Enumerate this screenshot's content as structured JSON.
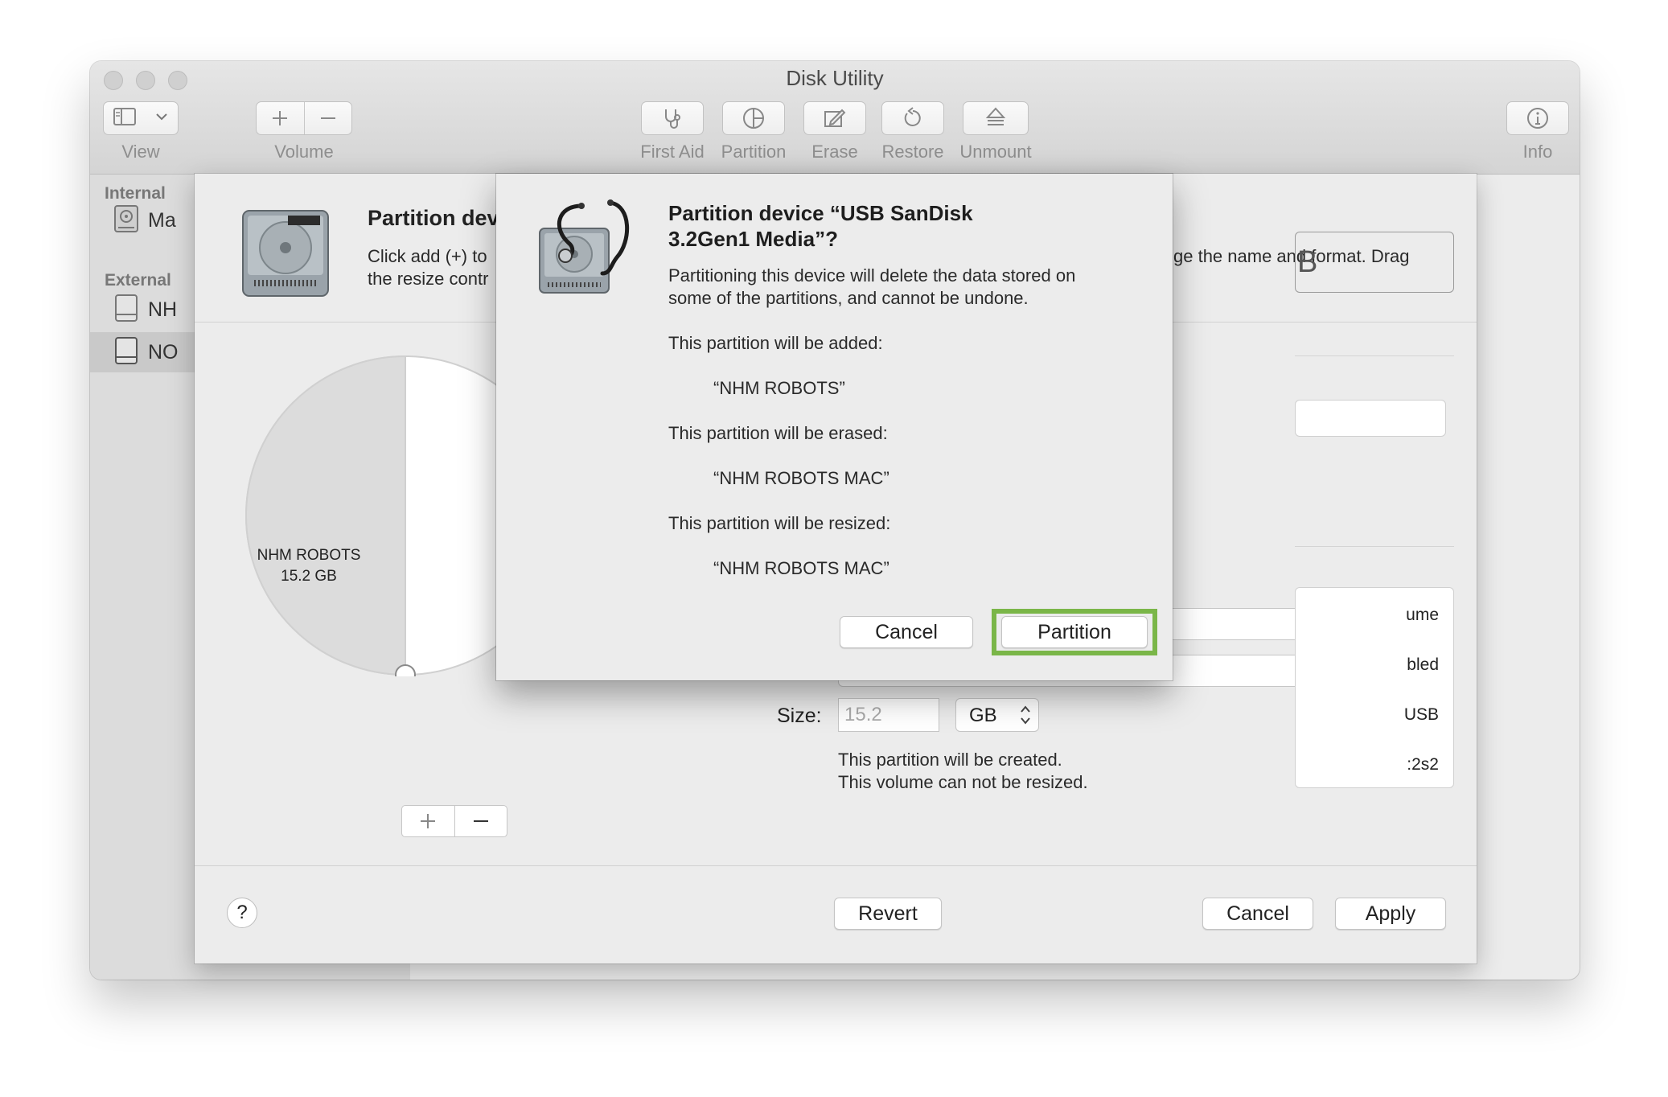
{
  "window": {
    "title": "Disk Utility",
    "toolbar": {
      "view": "View",
      "volume": "Volume",
      "first_aid": "First Aid",
      "partition": "Partition",
      "erase": "Erase",
      "restore": "Restore",
      "unmount": "Unmount",
      "info": "Info"
    }
  },
  "sidebar": {
    "internal_header": "Internal",
    "external_header": "External",
    "items": [
      {
        "label": "Ma"
      },
      {
        "label": "NH"
      },
      {
        "label": "NO"
      }
    ]
  },
  "sheet": {
    "title": "Partition dev",
    "desc_line1": "Click add (+) to",
    "desc_line2": "the resize contr",
    "desc_right": "ge the name and format. Drag",
    "right_box_text": "B",
    "pie": {
      "partition_name": "NHM ROBOTS",
      "partition_size": "15.2 GB",
      "fraction": 0.5
    },
    "size_label": "Size:",
    "size_value": "15.2",
    "size_unit": "GB",
    "created_note": "This partition will be created.",
    "resize_note": "This volume can not be resized.",
    "info_lines": [
      "ume",
      "bled",
      "USB",
      ":2s2"
    ],
    "help": "?",
    "revert": "Revert",
    "cancel": "Cancel",
    "apply": "Apply"
  },
  "dialog": {
    "title_line1": "Partition device “USB SanDisk",
    "title_line2": "3.2Gen1 Media”?",
    "message_line1": "Partitioning this device will delete the data stored on",
    "message_line2": "some of the partitions, and cannot be undone.",
    "added_label": "This partition will be added:",
    "added_name": "“NHM ROBOTS”",
    "erased_label": "This partition will be erased:",
    "erased_name": "“NHM ROBOTS MAC”",
    "resized_label": "This partition will be resized:",
    "resized_name": "“NHM ROBOTS MAC”",
    "cancel": "Cancel",
    "partition": "Partition",
    "highlight_color": "#7ab648"
  }
}
